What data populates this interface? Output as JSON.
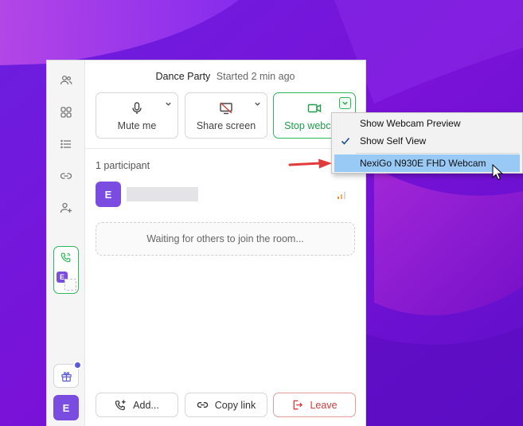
{
  "colors": {
    "accent_purple": "#7a4ce0",
    "active_green": "#2fb85a",
    "leave_red": "#d33d3d",
    "menu_highlight": "#99c9f5",
    "annotation_arrow": "#e03a3a"
  },
  "header": {
    "room_name": "Dance Party",
    "started_text": "Started 2 min ago"
  },
  "sidebar": {
    "icons": [
      "people-icon",
      "grid-icon",
      "list-icon",
      "link-icon",
      "add-person-icon"
    ],
    "call_card_avatar": "E",
    "user_avatar": "E"
  },
  "controls": {
    "mute_label": "Mute me",
    "share_label": "Share screen",
    "webcam_label": "Stop webcam"
  },
  "participants": {
    "count_label": "1 participant",
    "items": [
      {
        "initial": "E",
        "signal_icon": "signal-bars-icon"
      }
    ]
  },
  "waiting_text": "Waiting for others to join the room...",
  "footer": {
    "add_label": "Add...",
    "copy_link_label": "Copy link",
    "leave_label": "Leave"
  },
  "webcam_menu": {
    "items": [
      {
        "label": "Show Webcam Preview",
        "checked": false,
        "highlighted": false
      },
      {
        "label": "Show Self View",
        "checked": true,
        "highlighted": false
      },
      {
        "label": "NexiGo N930E FHD Webcam",
        "checked": false,
        "highlighted": true
      }
    ]
  }
}
